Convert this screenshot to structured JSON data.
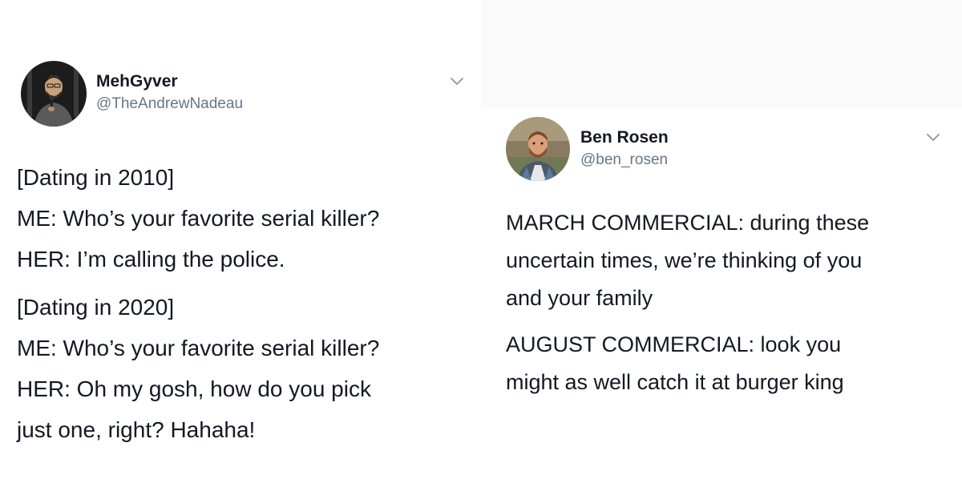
{
  "tweets": [
    {
      "display_name": "MehGyver",
      "handle": "@TheAndrewNadeau",
      "lines_block_1": [
        "[Dating in 2010]",
        "ME: Who’s your favorite serial killer?",
        "HER: I’m calling the police."
      ],
      "lines_block_2": [
        "[Dating in 2020]",
        "ME: Who’s your favorite serial killer?",
        "HER: Oh my gosh, how do you pick",
        "just one, right? Hahaha!"
      ],
      "avatar_icon": "person-holding-microphone-avatar",
      "menu_icon": "chevron-down-icon"
    },
    {
      "display_name": "Ben Rosen",
      "handle": "@ben_rosen",
      "lines_block_1": [
        "MARCH COMMERCIAL: during these",
        "uncertain times, we’re thinking of you",
        "and your family"
      ],
      "lines_block_2": [
        "AUGUST COMMERCIAL: look you",
        "might as well catch it at burger king"
      ],
      "avatar_icon": "bearded-man-avatar",
      "menu_icon": "chevron-down-icon"
    }
  ],
  "colors": {
    "text": "#141823",
    "handle": "#657786",
    "chevron": "#8899a6",
    "background": "#ffffff"
  }
}
